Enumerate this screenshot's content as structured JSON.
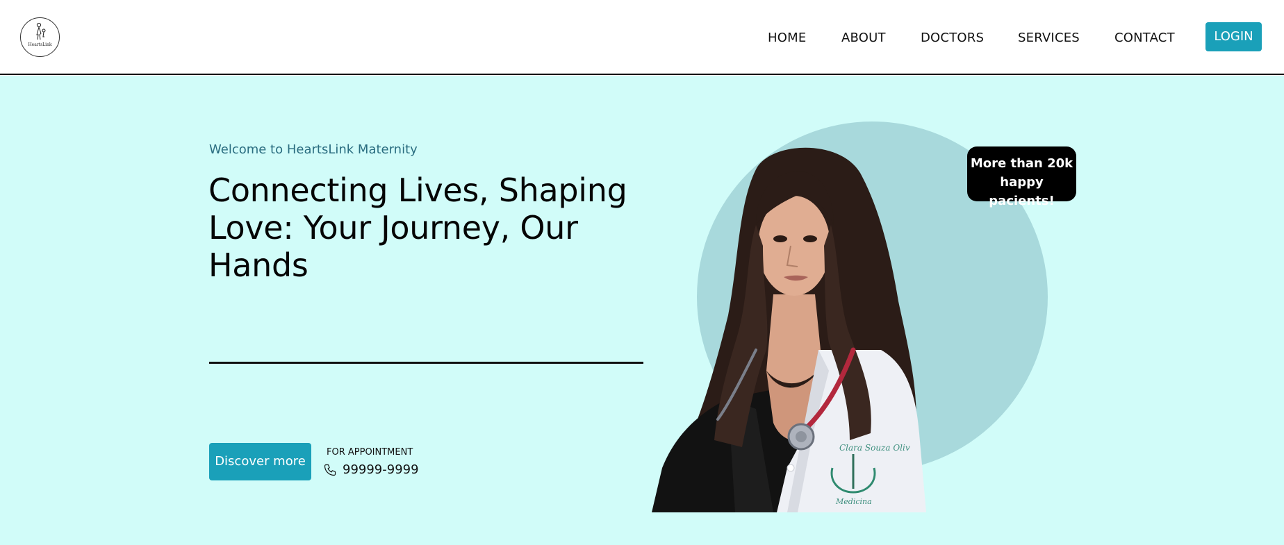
{
  "header": {
    "logo_text": "HeartsLink",
    "logo_icon": "mother-and-child-icon",
    "nav": [
      "HOME",
      "ABOUT",
      "DOCTORS",
      "SERVICES",
      "CONTACT"
    ],
    "login_label": "LOGIN"
  },
  "hero": {
    "welcome": "Welcome to HeartsLink Maternity",
    "heading": "Connecting Lives, Shaping Love: Your Journey, Our Hands",
    "discover_label": "Discover more",
    "appointment_label": "FOR APPOINTMENT",
    "phone_icon": "phone-icon",
    "phone": "99999-9999",
    "badge_line1": "More than 20k",
    "badge_line2": "happy pacients!",
    "coat_name": "Clara Souza Oliv",
    "coat_caption": "Medicina"
  },
  "colors": {
    "accent": "#1aa0b9",
    "hero_bg": "#d1fcf9",
    "circle": "#a8d9dc",
    "welcome": "#2a6d80",
    "badge_bg": "#000000"
  }
}
